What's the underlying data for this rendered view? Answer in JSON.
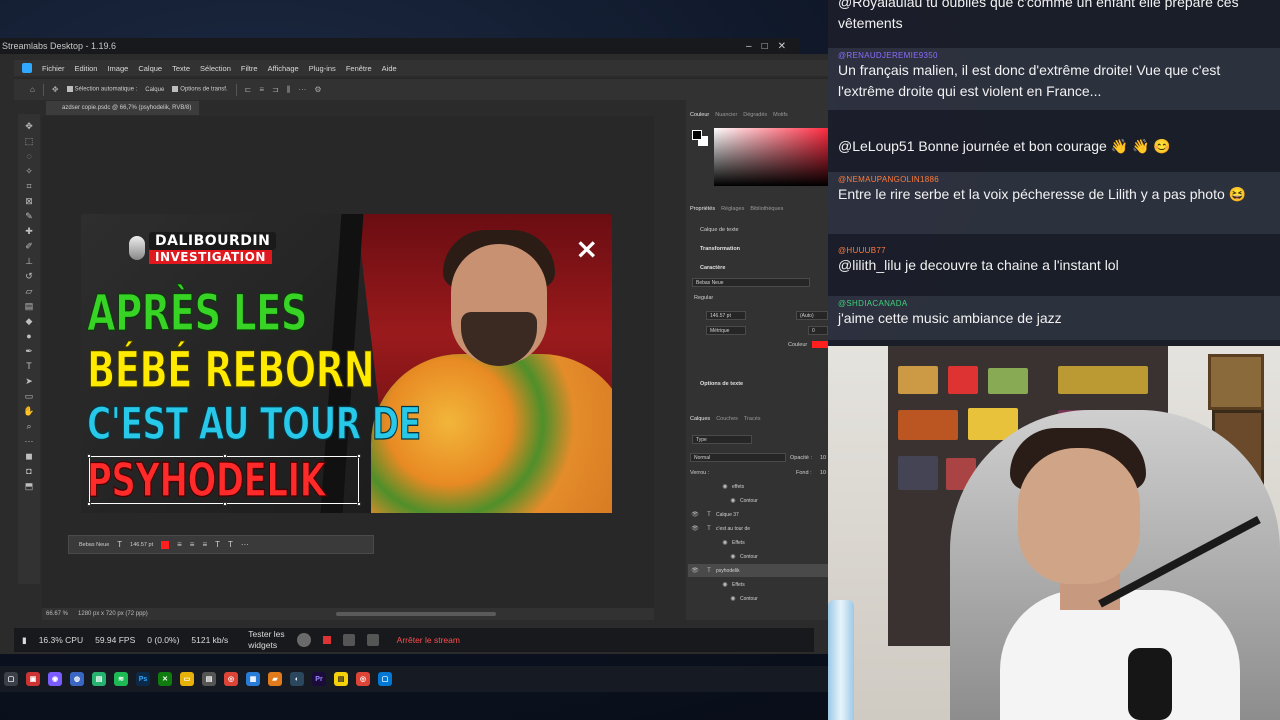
{
  "streamlabs": {
    "title": "Streamlabs Desktop - 1.19.6",
    "window_controls": [
      "–",
      "□",
      "✕"
    ],
    "bottom_bar": {
      "cpu": "16.3% CPU",
      "fps": "59.94 FPS",
      "dropped": "0 (0.0%)",
      "bandwidth": "5121 kb/s",
      "test_widgets_line1": "Tester les",
      "test_widgets_line2": "widgets",
      "stop_stream": "Arrêter le stream"
    }
  },
  "photoshop": {
    "menu": [
      "Fichier",
      "Edition",
      "Image",
      "Calque",
      "Texte",
      "Sélection",
      "Filtre",
      "Affichage",
      "Plug-ins",
      "Fenêtre",
      "Aide"
    ],
    "options_bar": {
      "auto_select": "Sélection automatique :",
      "layer_select": "Calque",
      "transform_options": "Options de transf."
    },
    "doc_tab": "azdser copie.psdc @ 66,7% (psyhodelik, RVB/8)",
    "status": {
      "zoom": "66.67 %",
      "dimensions": "1280 px x 720 px (72 ppp)"
    },
    "floating_toolbar": {
      "font": "Bebas Neue",
      "size": "146.57 pt"
    },
    "panels": {
      "color_tabs": [
        "Couleur",
        "Nuancier",
        "Dégradés",
        "Motifs"
      ],
      "props_tabs": [
        "Propriétés",
        "Réglages",
        "Bibliothèques"
      ],
      "layer_kind": "Calque de texte",
      "transformation": "Transformation",
      "character": "Caractère",
      "font": "Bebas Neue",
      "style": "Regular",
      "size": "146.57 pt",
      "leading": "(Auto)",
      "tracking_label": "Métrique",
      "tracking": "0",
      "color_label": "Couleur",
      "text_options": "Options de texte",
      "layers_tabs": [
        "Calques",
        "Couches",
        "Tracés"
      ],
      "layer_filter": "Type",
      "blend_mode": "Normal",
      "opacity_label": "Opacité :",
      "opacity": "10",
      "lock_label": "Verrou :",
      "fill_label": "Fond :",
      "fill": "10",
      "layers": [
        {
          "name": "effets",
          "type": "fx",
          "indent": 2
        },
        {
          "name": "Contour",
          "type": "effect",
          "indent": 3
        },
        {
          "name": "Calque 37",
          "type": "text",
          "indent": 0
        },
        {
          "name": "c'est au tour de",
          "type": "text",
          "indent": 0
        },
        {
          "name": "Effets",
          "type": "fx",
          "indent": 2
        },
        {
          "name": "Contour",
          "type": "effect",
          "indent": 3
        },
        {
          "name": "psyhodelik",
          "type": "text",
          "indent": 0,
          "selected": true
        },
        {
          "name": "Effets",
          "type": "fx",
          "indent": 2
        },
        {
          "name": "Contour",
          "type": "effect",
          "indent": 3
        }
      ]
    }
  },
  "thumbnail": {
    "badge_top": "DALIBOURDIN",
    "badge_bottom": "INVESTIGATION",
    "line1": "APRÈS LES",
    "line2": "BÉBÉ REBORN",
    "line3": "C'EST AU TOUR DE",
    "line4": "PSYHODELIK",
    "brand_mark": "×",
    "colors": {
      "line1": "#37d426",
      "line2": "#ffea00",
      "line3": "#27c8e8",
      "line4": "#ff2a2a"
    }
  },
  "chat": {
    "messages": [
      {
        "user": "",
        "user_color": "#a9a9ff",
        "text": "@Royalaulau tu oublies que c'comme un enfant elle prépare ces vêtements"
      },
      {
        "user": "@RENAUDJEREMIE9350",
        "user_color": "#8b6cff",
        "text": "Un français malien, il est donc d'extrême droite! Vue que c'est l'extrême droite qui est violent en France..."
      },
      {
        "user": "",
        "user_color": "#6b8cff",
        "text": "@LeLoup51 Bonne journée et bon courage 👋 👋 😊"
      },
      {
        "user": "@NEMAUPANGOLIN1886",
        "user_color": "#ff7a3d",
        "text": "Entre le rire serbe et la voix pécheresse de Lilith y a pas photo 😆"
      },
      {
        "user": "@HUUUB77",
        "user_color": "#ff7a3d",
        "text": "@lilith_lilu je decouvre ta chaine a l'instant lol"
      },
      {
        "user": "@SHDIACANADA",
        "user_color": "#3fd17a",
        "text": "j'aime cette music ambiance de jazz"
      }
    ]
  }
}
